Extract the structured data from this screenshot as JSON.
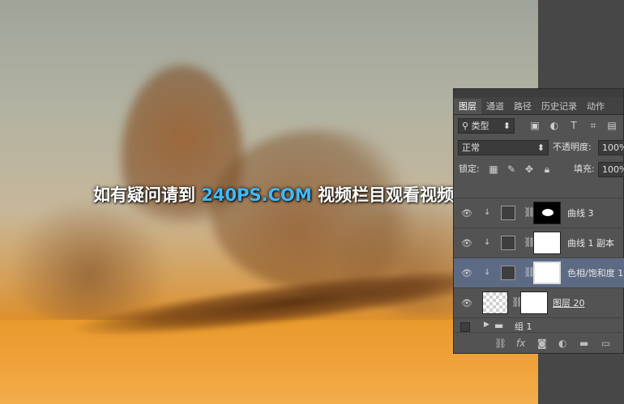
{
  "watermark": {
    "prefix": "如有疑问请到 ",
    "site": "240PS.COM",
    "suffix": " 视频栏目观看视频教程"
  },
  "panel": {
    "tabs": [
      "图层",
      "通道",
      "路径",
      "历史记录",
      "动作"
    ],
    "active_tab": "图层",
    "filter": {
      "label": "类型"
    },
    "blend_mode": "正常",
    "opacity": {
      "label": "不透明度:",
      "value": "100%"
    },
    "lock": {
      "label": "锁定:"
    },
    "fill": {
      "label": "填充:",
      "value": "100%"
    },
    "layers": [
      {
        "name": "曲线 3",
        "type": "curves",
        "mask": "black-with-white-blob",
        "clipped": true,
        "visible": true,
        "selected": false
      },
      {
        "name": "曲线 1 副本",
        "type": "curves",
        "mask": "white",
        "clipped": true,
        "visible": true,
        "selected": false
      },
      {
        "name": "色相/饱和度 1",
        "type": "hue-saturation",
        "mask": "white",
        "clipped": true,
        "visible": true,
        "selected": true
      },
      {
        "name": "图层 20",
        "type": "pixel",
        "mask": "partial",
        "clipped": false,
        "visible": true,
        "selected": false
      },
      {
        "name": "组 1",
        "type": "group",
        "clipped": false,
        "visible": false,
        "selected": false
      }
    ],
    "footer_icons": [
      "link-icon",
      "fx-icon",
      "mask-icon",
      "adjustment-icon",
      "folder-icon",
      "new-layer-icon"
    ]
  },
  "colors": {
    "selected_row": "#5d6a84",
    "panel_bg": "#535353",
    "watermark_highlight": "#3fb9ff"
  }
}
